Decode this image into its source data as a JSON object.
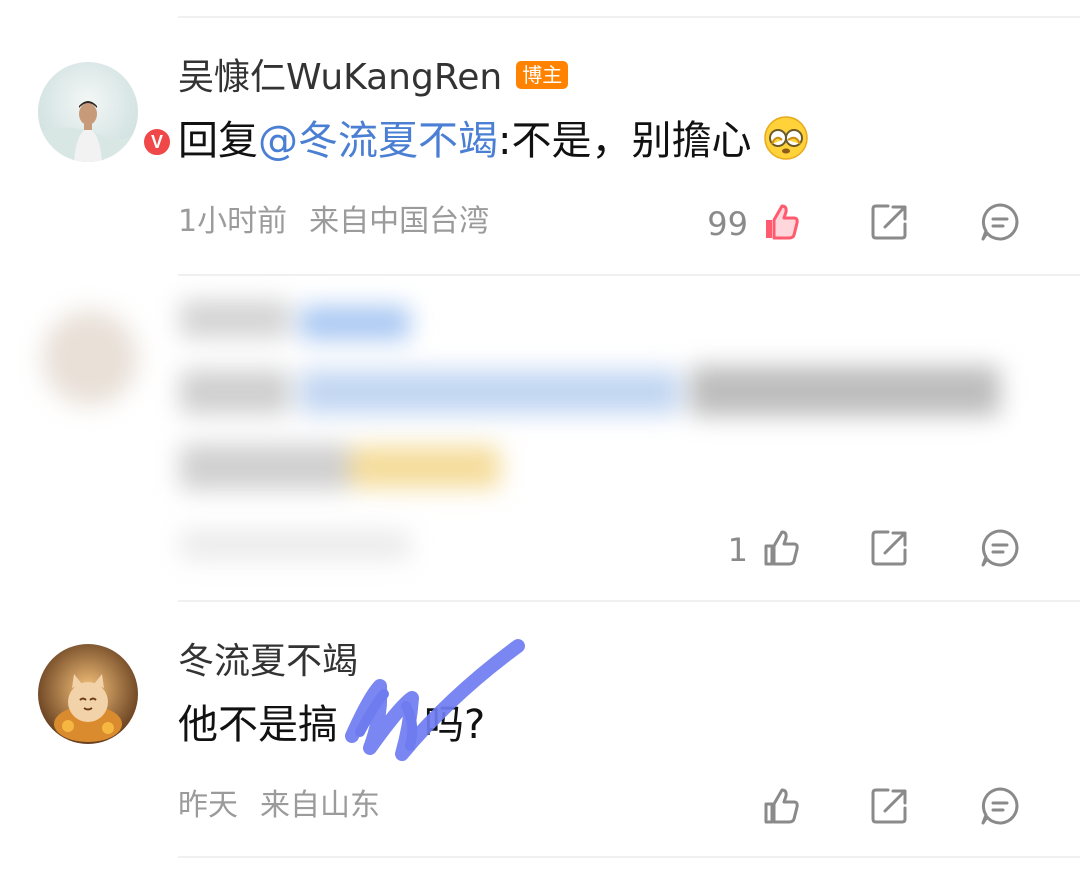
{
  "comments": [
    {
      "username": "吴慷仁WuKangRen",
      "badge": "博主",
      "verified_mark": "V",
      "reply_prefix": "回复",
      "mention": "@冬流夏不竭",
      "text": ":不是，别擔心",
      "emoji": "eyes-covered-emoji",
      "time": "1小时前",
      "location": "来自中国台湾",
      "likes": "99",
      "liked": true
    },
    {
      "blurred": true,
      "likes": "1",
      "liked": false
    },
    {
      "username": "冬流夏不竭",
      "text_visible": "他不是搞",
      "text_tail": "吗?",
      "time": "昨天",
      "location": "来自山东",
      "likes": "",
      "liked": false
    }
  ],
  "colors": {
    "like_active": "#ff5a6e",
    "mention": "#4a7fd4",
    "badge": "#ff8200",
    "scribble": "#6f7cf0"
  },
  "icons": [
    "thumbs-up-icon",
    "share-icon",
    "comment-icon"
  ]
}
